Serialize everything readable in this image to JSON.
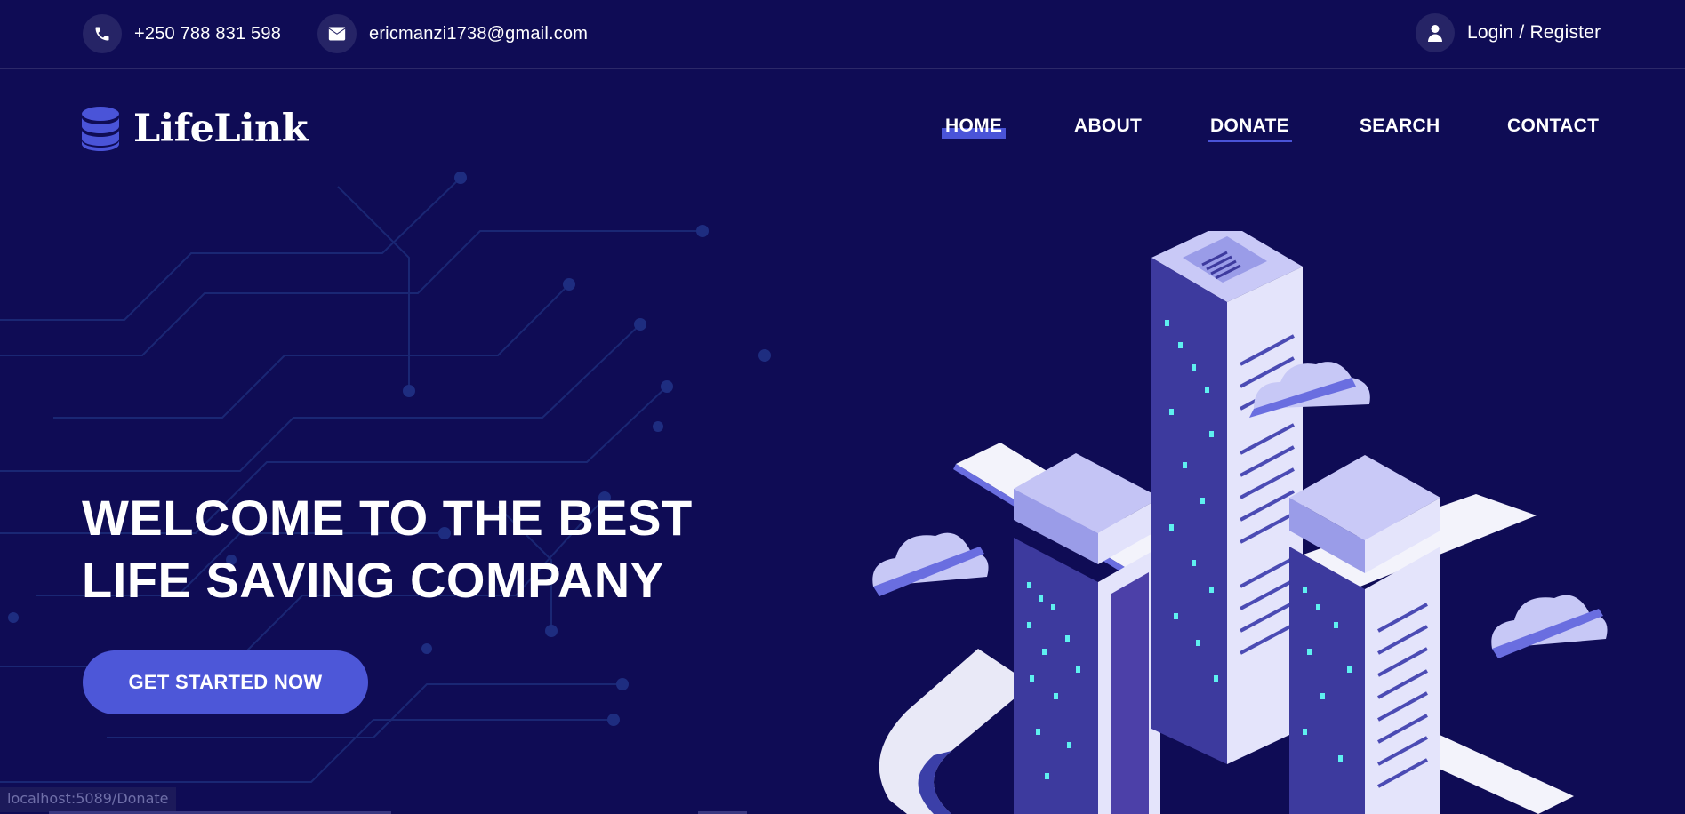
{
  "topbar": {
    "phone": "+250 788 831 598",
    "email": "ericmanzi1738@gmail.com",
    "login": "Login / Register",
    "icons": [
      "phone-icon",
      "envelope-icon",
      "user-icon"
    ]
  },
  "brand": {
    "name": "LifeLink",
    "logo_icon": "database-icon"
  },
  "nav": {
    "items": [
      "HOME",
      "ABOUT",
      "DONATE",
      "SEARCH",
      "CONTACT"
    ],
    "active": "HOME"
  },
  "hero": {
    "title_line1": "WELCOME TO THE BEST",
    "title_line2": "LIFE SAVING COMPANY",
    "cta_label": "GET STARTED NOW"
  },
  "status_bar": {
    "url": "localhost:5089/Donate"
  },
  "colors": {
    "background": "#0f0c55",
    "accent": "#4d57d8",
    "chip": "#262466"
  }
}
